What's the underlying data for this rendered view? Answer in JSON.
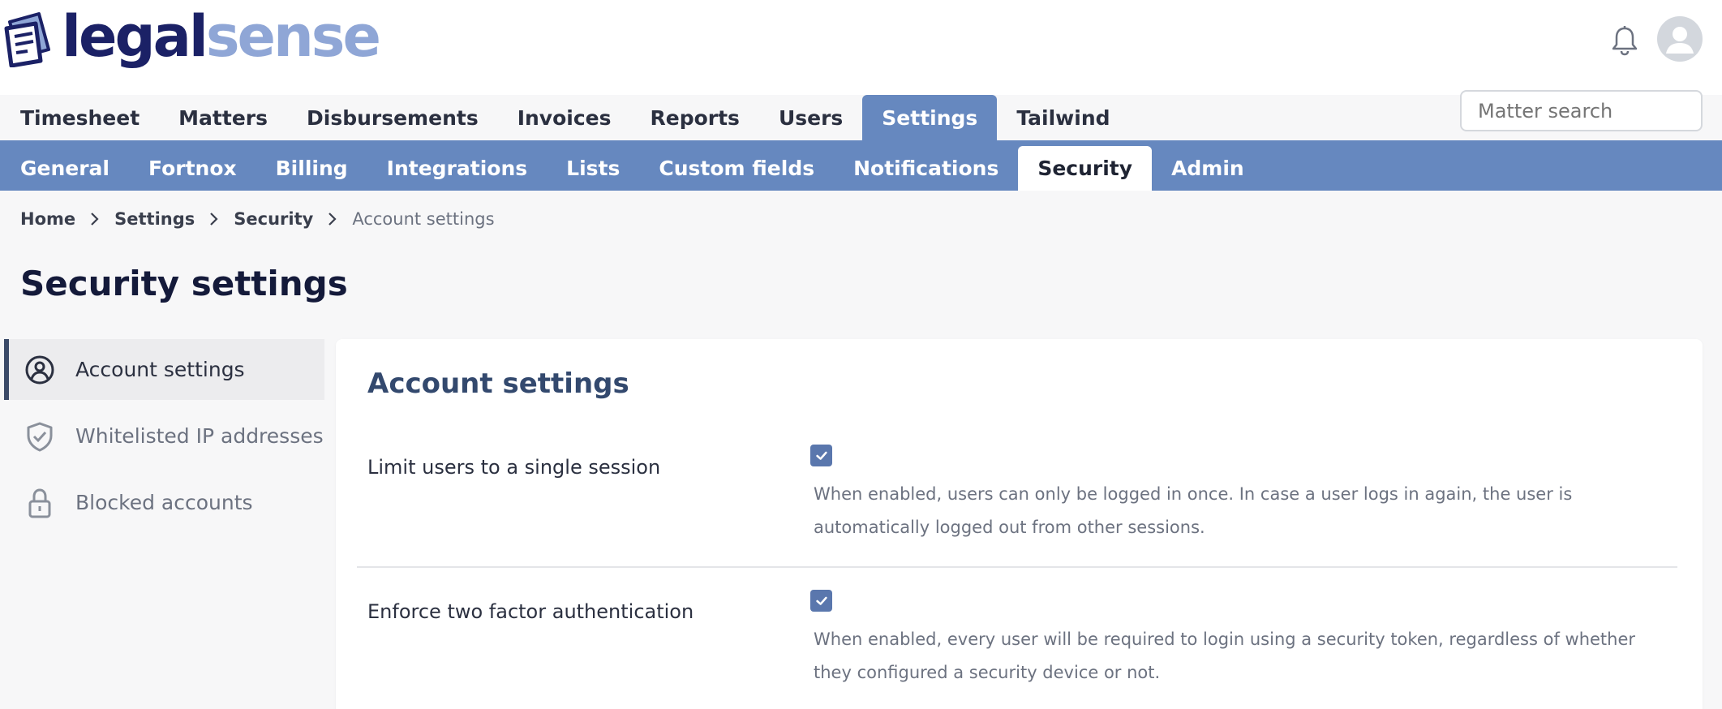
{
  "brand": {
    "name_part1": "legal",
    "name_part2": "sense"
  },
  "main_nav": {
    "tabs": [
      {
        "label": "Timesheet",
        "active": false
      },
      {
        "label": "Matters",
        "active": false
      },
      {
        "label": "Disbursements",
        "active": false
      },
      {
        "label": "Invoices",
        "active": false
      },
      {
        "label": "Reports",
        "active": false
      },
      {
        "label": "Users",
        "active": false
      },
      {
        "label": "Settings",
        "active": true
      },
      {
        "label": "Tailwind",
        "active": false
      }
    ],
    "search_placeholder": "Matter search"
  },
  "sub_nav": {
    "tabs": [
      {
        "label": "General",
        "active": false
      },
      {
        "label": "Fortnox",
        "active": false
      },
      {
        "label": "Billing",
        "active": false
      },
      {
        "label": "Integrations",
        "active": false
      },
      {
        "label": "Lists",
        "active": false
      },
      {
        "label": "Custom fields",
        "active": false
      },
      {
        "label": "Notifications",
        "active": false
      },
      {
        "label": "Security",
        "active": true
      },
      {
        "label": "Admin",
        "active": false
      }
    ]
  },
  "breadcrumb": {
    "home": "Home",
    "settings": "Settings",
    "security": "Security",
    "current": "Account settings"
  },
  "page_title": "Security settings",
  "sidebar": {
    "items": [
      {
        "label": "Account settings",
        "icon": "user-circle-icon",
        "active": true
      },
      {
        "label": "Whitelisted IP addresses",
        "icon": "shield-check-icon",
        "active": false
      },
      {
        "label": "Blocked accounts",
        "icon": "lock-icon",
        "active": false
      }
    ]
  },
  "card": {
    "title": "Account settings",
    "settings": [
      {
        "label": "Limit users to a single session",
        "checked": true,
        "description": "When enabled, users can only be logged in once. In case a user logs in again, the user is automatically logged out from other sessions."
      },
      {
        "label": "Enforce two factor authentication",
        "checked": true,
        "description": "When enabled, every user will be required to login using a security token, regardless of whether they configured a security device or not."
      }
    ]
  },
  "colors": {
    "accent": "#6688bf",
    "brand_dark": "#1b2166",
    "brand_light": "#8fa6d6",
    "checkbox": "#5a77ad"
  }
}
